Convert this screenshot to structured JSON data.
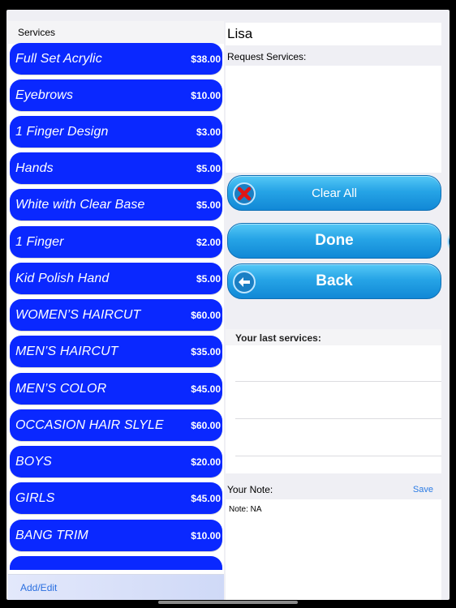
{
  "services_panel": {
    "header": "Services",
    "items": [
      {
        "name": "Full Set Acrylic",
        "price": "$38.00"
      },
      {
        "name": "Eyebrows",
        "price": "$10.00"
      },
      {
        "name": "1 Finger Design",
        "price": "$3.00"
      },
      {
        "name": "Hands",
        "price": "$5.00"
      },
      {
        "name": "White with Clear Base",
        "price": "$5.00"
      },
      {
        "name": "1 Finger",
        "price": "$2.00"
      },
      {
        "name": "Kid Polish Hand",
        "price": "$5.00"
      },
      {
        "name": "WOMEN’S HAIRCUT",
        "price": "$60.00"
      },
      {
        "name": "MEN’S HAIRCUT",
        "price": "$35.00"
      },
      {
        "name": "MEN’S COLOR",
        "price": "$45.00"
      },
      {
        "name": "OCCASION HAIR SLYLE",
        "price": "$60.00"
      },
      {
        "name": "BOYS",
        "price": "$20.00"
      },
      {
        "name": "GIRLS",
        "price": "$45.00"
      },
      {
        "name": "BANG TRIM",
        "price": "$10.00"
      }
    ],
    "footer_link": "Add/Edit"
  },
  "client": {
    "name": "Lisa",
    "request_label": "Request Services:"
  },
  "actions": {
    "clear_all": "Clear All",
    "done": "Done",
    "back": "Back"
  },
  "history": {
    "label": "Your last services:"
  },
  "note": {
    "label": "Your Note:",
    "save": "Save",
    "text": "Note: NA"
  },
  "icons": {
    "clear": "red-x-icon",
    "done": "arrow-right-icon",
    "back": "arrow-left-icon"
  },
  "colors": {
    "service_button": "#0a28ff",
    "action_button": "#26a4e6",
    "link": "#2a7be4"
  }
}
